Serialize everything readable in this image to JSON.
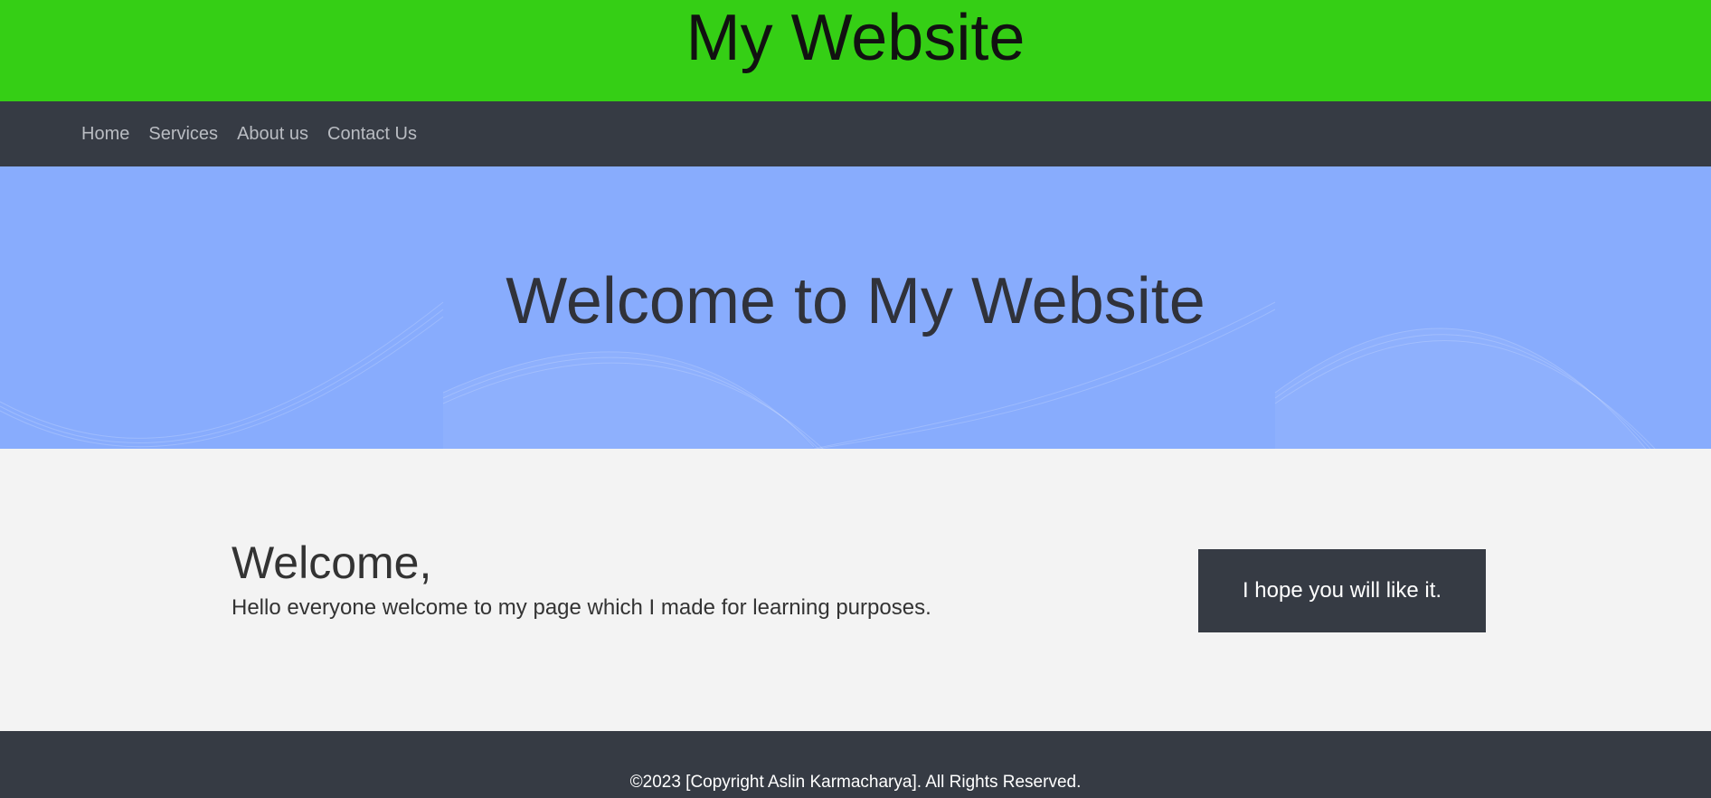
{
  "header": {
    "title": "My Website",
    "color": "#35cf15"
  },
  "nav": {
    "items": [
      {
        "label": "Home"
      },
      {
        "label": "Services"
      },
      {
        "label": "About us"
      },
      {
        "label": "Contact Us"
      }
    ]
  },
  "hero": {
    "title": "Welcome to My Website",
    "color": "#88acfd"
  },
  "main": {
    "heading": "Welcome,",
    "text": "Hello everyone welcome to my page which I made for learning purposes.",
    "callout": "I hope you will like it."
  },
  "footer": {
    "text": "©2023 [Copyright Aslin Karmacharya]. All Rights Reserved."
  }
}
